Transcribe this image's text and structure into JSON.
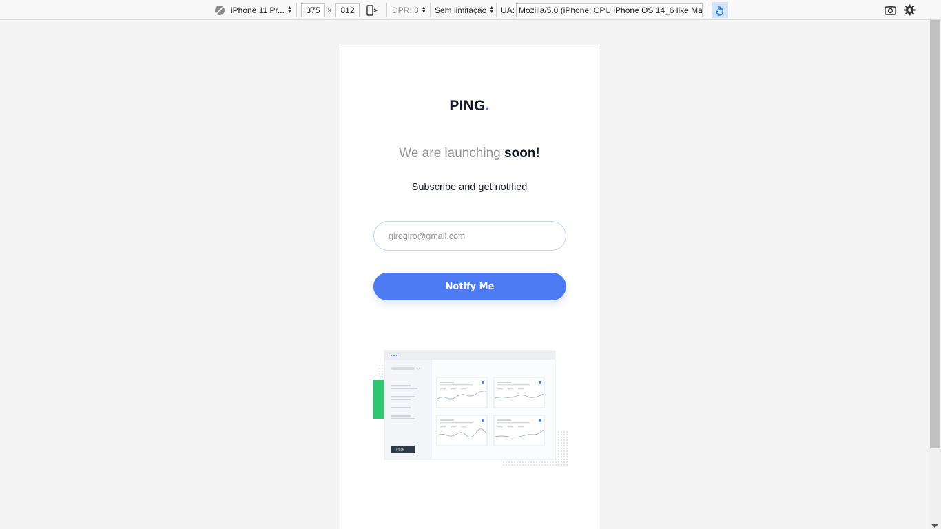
{
  "devtools": {
    "device": "iPhone 11 Pr...",
    "width": "375",
    "times": "×",
    "height": "812",
    "dpr": "DPR: 3",
    "throttle": "Sem limitação",
    "ua_label": "UA:",
    "ua_value": "Mozilla/5.0 (iPhone; CPU iPhone OS 14_6 like Mac"
  },
  "page": {
    "logo": "PING",
    "logo_dot": ".",
    "headline_light": "We are launching ",
    "headline_bold": "soon!",
    "subtitle": "Subscribe and get notified",
    "email_placeholder": "girogiro@gmail.com",
    "button": "Notify Me",
    "illustration_brand": "slack"
  },
  "colors": {
    "accent": "#4c7bf3",
    "dark": "#121725",
    "gray": "#969696",
    "green": "#2fc46e"
  }
}
